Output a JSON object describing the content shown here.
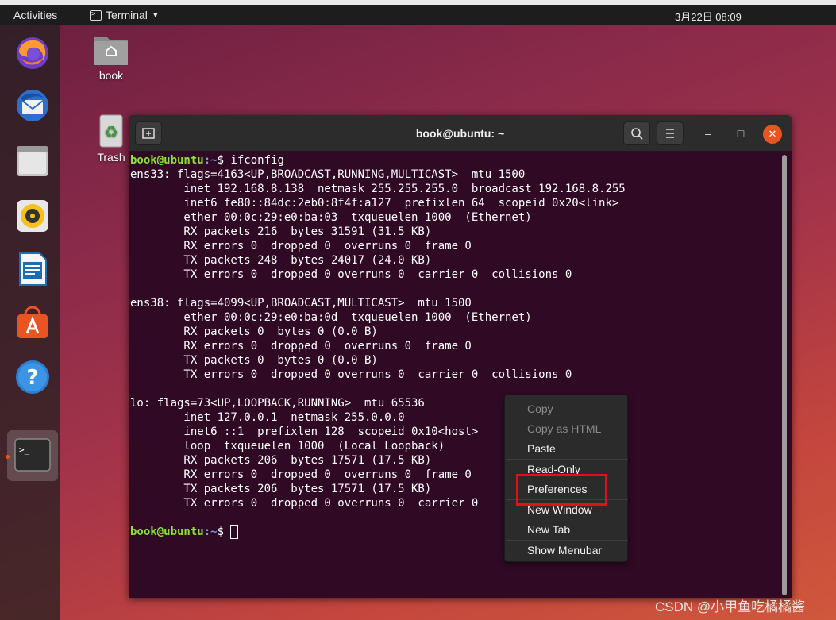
{
  "topbar": {
    "activities": "Activities",
    "app_name": "Terminal",
    "clock": "3月22日  08:09"
  },
  "desktop": {
    "home_folder": "book",
    "trash": "Trash"
  },
  "dock": {
    "items": [
      "firefox-icon",
      "thunderbird-icon",
      "files-icon",
      "rhythmbox-icon",
      "libreoffice-writer-icon",
      "ubuntu-software-icon",
      "help-icon",
      "terminal-icon"
    ],
    "accent": "#e95420"
  },
  "terminal": {
    "title": "book@ubuntu: ~",
    "prompt_user": "book@ubuntu",
    "prompt_path": ":~",
    "prompt_symbol": "$ ",
    "command": "ifconfig",
    "output": [
      "ens33: flags=4163<UP,BROADCAST,RUNNING,MULTICAST>  mtu 1500",
      "        inet 192.168.8.138  netmask 255.255.255.0  broadcast 192.168.8.255",
      "        inet6 fe80::84dc:2eb0:8f4f:a127  prefixlen 64  scopeid 0x20<link>",
      "        ether 00:0c:29:e0:ba:03  txqueuelen 1000  (Ethernet)",
      "        RX packets 216  bytes 31591 (31.5 KB)",
      "        RX errors 0  dropped 0  overruns 0  frame 0",
      "        TX packets 248  bytes 24017 (24.0 KB)",
      "        TX errors 0  dropped 0 overruns 0  carrier 0  collisions 0",
      "",
      "ens38: flags=4099<UP,BROADCAST,MULTICAST>  mtu 1500",
      "        ether 00:0c:29:e0:ba:0d  txqueuelen 1000  (Ethernet)",
      "        RX packets 0  bytes 0 (0.0 B)",
      "        RX errors 0  dropped 0  overruns 0  frame 0",
      "        TX packets 0  bytes 0 (0.0 B)",
      "        TX errors 0  dropped 0 overruns 0  carrier 0  collisions 0",
      "",
      "lo: flags=73<UP,LOOPBACK,RUNNING>  mtu 65536",
      "        inet 127.0.0.1  netmask 255.0.0.0",
      "        inet6 ::1  prefixlen 128  scopeid 0x10<host>",
      "        loop  txqueuelen 1000  (Local Loopback)",
      "        RX packets 206  bytes 17571 (17.5 KB)",
      "        RX errors 0  dropped 0  overruns 0  frame 0",
      "        TX packets 206  bytes 17571 (17.5 KB)",
      "        TX errors 0  dropped 0 overruns 0  carrier 0",
      ""
    ]
  },
  "context_menu": {
    "copy": "Copy",
    "copy_html": "Copy as HTML",
    "paste": "Paste",
    "read_only": "Read-Only",
    "preferences": "Preferences",
    "new_window": "New Window",
    "new_tab": "New Tab",
    "show_menubar": "Show Menubar"
  },
  "watermark": "CSDN @小甲鱼吃橘橘酱"
}
